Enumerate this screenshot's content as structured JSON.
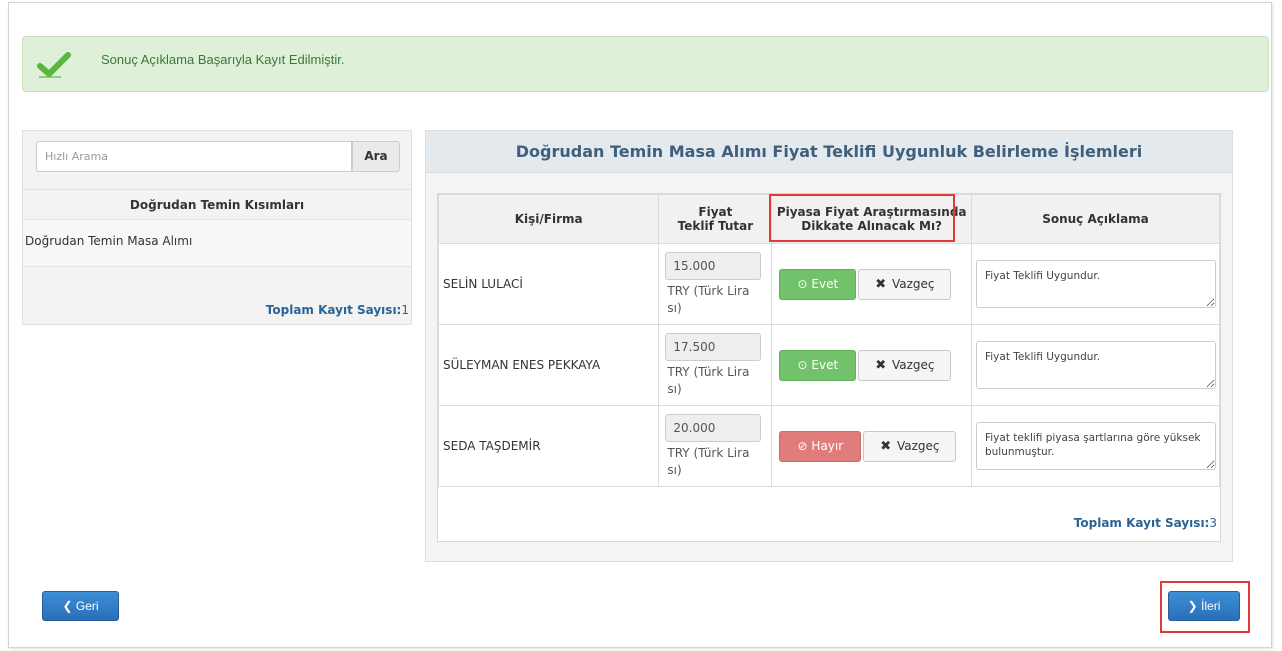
{
  "alert": {
    "message": "Sonuç Açıklama Başarıyla Kayıt Edilmiştir.",
    "icon": "checkmark-icon",
    "color": "#3c763d"
  },
  "search": {
    "placeholder": "Hızlı Arama",
    "button_label": "Ara"
  },
  "left_panel": {
    "header": "Doğrudan Temin Kısımları",
    "items": [
      {
        "label": "Doğrudan Temin Masa Alımı"
      }
    ],
    "total_label": "Toplam Kayıt Sayısı:",
    "total_value": "1"
  },
  "main_panel": {
    "title": "Doğrudan Temin Masa Alımı Fiyat Teklifi Uygunluk Belirleme İşlemleri",
    "columns": {
      "firm": "Kişi/Firma",
      "price_line1": "Fiyat",
      "price_line2": "Teklif Tutar",
      "market_line1": "Piyasa Fiyat Araştırmasında",
      "market_line2": "Dikkate Alınacak Mı?",
      "result": "Sonuç Açıklama"
    },
    "rows": [
      {
        "name": "SELİN LULACİ",
        "price": "15.000",
        "currency": "TRY (Türk Lira sı)",
        "decision": "Evet",
        "cancel": "Vazgeç",
        "note": "Fiyat Teklifi Uygundur."
      },
      {
        "name": "SÜLEYMAN ENES PEKKAYA",
        "price": "17.500",
        "currency": "TRY (Türk Lira sı)",
        "decision": "Evet",
        "cancel": "Vazgeç",
        "note": "Fiyat Teklifi Uygundur."
      },
      {
        "name": "SEDA TAŞDEMİR",
        "price": "20.000",
        "currency": "TRY (Türk Lira sı)",
        "decision": "Hayır",
        "cancel": "Vazgeç",
        "note": "Fiyat teklifi piyasa şartlarına göre yüksek bulunmuştur."
      }
    ],
    "total_label": "Toplam Kayıt Sayısı:",
    "total_value": "3"
  },
  "nav": {
    "back_label": "Geri",
    "next_label": "İleri"
  },
  "colors": {
    "accept": "#71c26a",
    "reject": "#e07d7b",
    "primary": "#2a6fb8",
    "highlight": "#e03a3a"
  }
}
